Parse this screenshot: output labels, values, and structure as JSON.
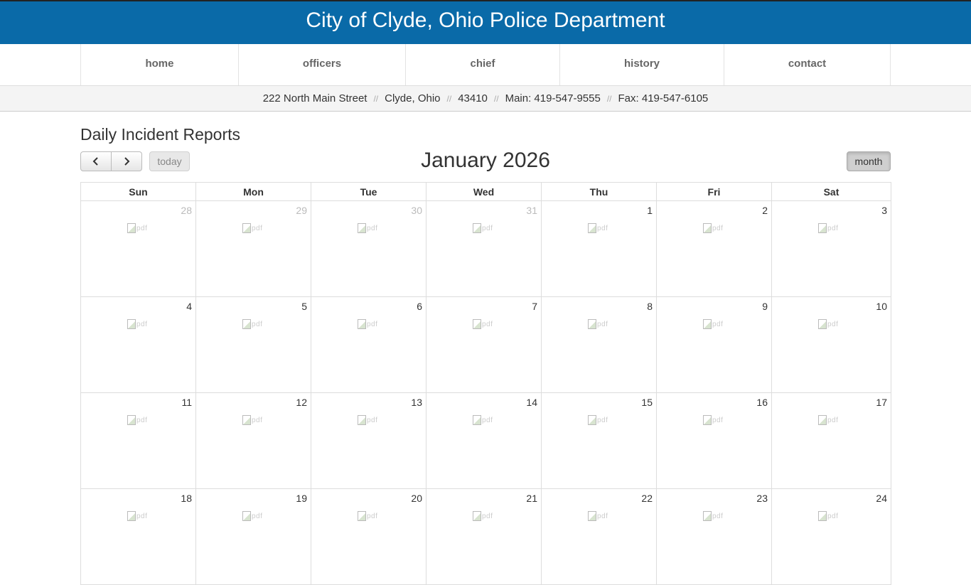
{
  "site": {
    "title": "City of Clyde, Ohio Police Department"
  },
  "nav": {
    "items": [
      {
        "label": "home"
      },
      {
        "label": "officers"
      },
      {
        "label": "chief"
      },
      {
        "label": "history"
      },
      {
        "label": "contact"
      }
    ]
  },
  "address_bar": {
    "street": "222 North Main Street",
    "city": "Clyde, Ohio",
    "zip": "43410",
    "main": "Main: 419-547-9555",
    "fax": "Fax: 419-547-6105",
    "separator": "//"
  },
  "page": {
    "heading": "Daily Incident Reports"
  },
  "calendar": {
    "title": "January 2026",
    "prev_icon": "chevron-left-icon",
    "next_icon": "chevron-right-icon",
    "today_label": "today",
    "view_label": "month",
    "weekdays": [
      "Sun",
      "Mon",
      "Tue",
      "Wed",
      "Thu",
      "Fri",
      "Sat"
    ],
    "report_alt": "pdf",
    "weeks": [
      [
        {
          "day": "28",
          "other_month": true
        },
        {
          "day": "29",
          "other_month": true
        },
        {
          "day": "30",
          "other_month": true
        },
        {
          "day": "31",
          "other_month": true
        },
        {
          "day": "1",
          "other_month": false
        },
        {
          "day": "2",
          "other_month": false
        },
        {
          "day": "3",
          "other_month": false
        }
      ],
      [
        {
          "day": "4",
          "other_month": false
        },
        {
          "day": "5",
          "other_month": false
        },
        {
          "day": "6",
          "other_month": false
        },
        {
          "day": "7",
          "other_month": false
        },
        {
          "day": "8",
          "other_month": false
        },
        {
          "day": "9",
          "other_month": false
        },
        {
          "day": "10",
          "other_month": false
        }
      ],
      [
        {
          "day": "11",
          "other_month": false
        },
        {
          "day": "12",
          "other_month": false
        },
        {
          "day": "13",
          "other_month": false
        },
        {
          "day": "14",
          "other_month": false
        },
        {
          "day": "15",
          "other_month": false
        },
        {
          "day": "16",
          "other_month": false
        },
        {
          "day": "17",
          "other_month": false
        }
      ],
      [
        {
          "day": "18",
          "other_month": false
        },
        {
          "day": "19",
          "other_month": false
        },
        {
          "day": "20",
          "other_month": false
        },
        {
          "day": "21",
          "other_month": false
        },
        {
          "day": "22",
          "other_month": false
        },
        {
          "day": "23",
          "other_month": false
        },
        {
          "day": "24",
          "other_month": false
        }
      ]
    ]
  }
}
